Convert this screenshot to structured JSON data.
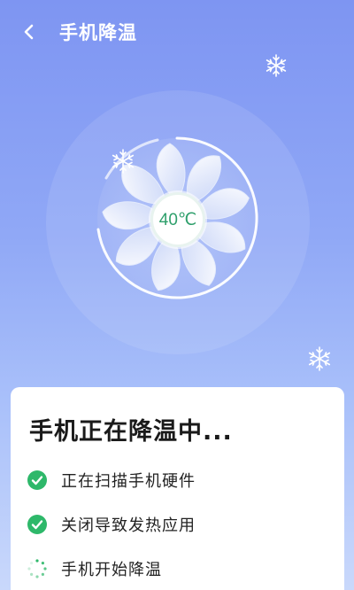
{
  "header": {
    "title": "手机降温",
    "back_icon": "chevron-left-icon"
  },
  "hero": {
    "temperature": "40℃",
    "fan_icon": "fan-icon",
    "snowflake_icon": "snowflake-icon"
  },
  "card": {
    "title": "手机正在降温中...",
    "steps": [
      {
        "label": "正在扫描手机硬件",
        "status": "done",
        "icon": "check-circle-icon"
      },
      {
        "label": "关闭导致发热应用",
        "status": "done",
        "icon": "check-circle-icon"
      },
      {
        "label": "手机开始降温",
        "status": "in-progress",
        "icon": "spinner-icon"
      }
    ]
  },
  "colors": {
    "background_top": "#7e95f2",
    "background_bottom": "#c9d8fb",
    "accent_green": "#2eb86a",
    "temperature_text": "#2e9f6b"
  }
}
